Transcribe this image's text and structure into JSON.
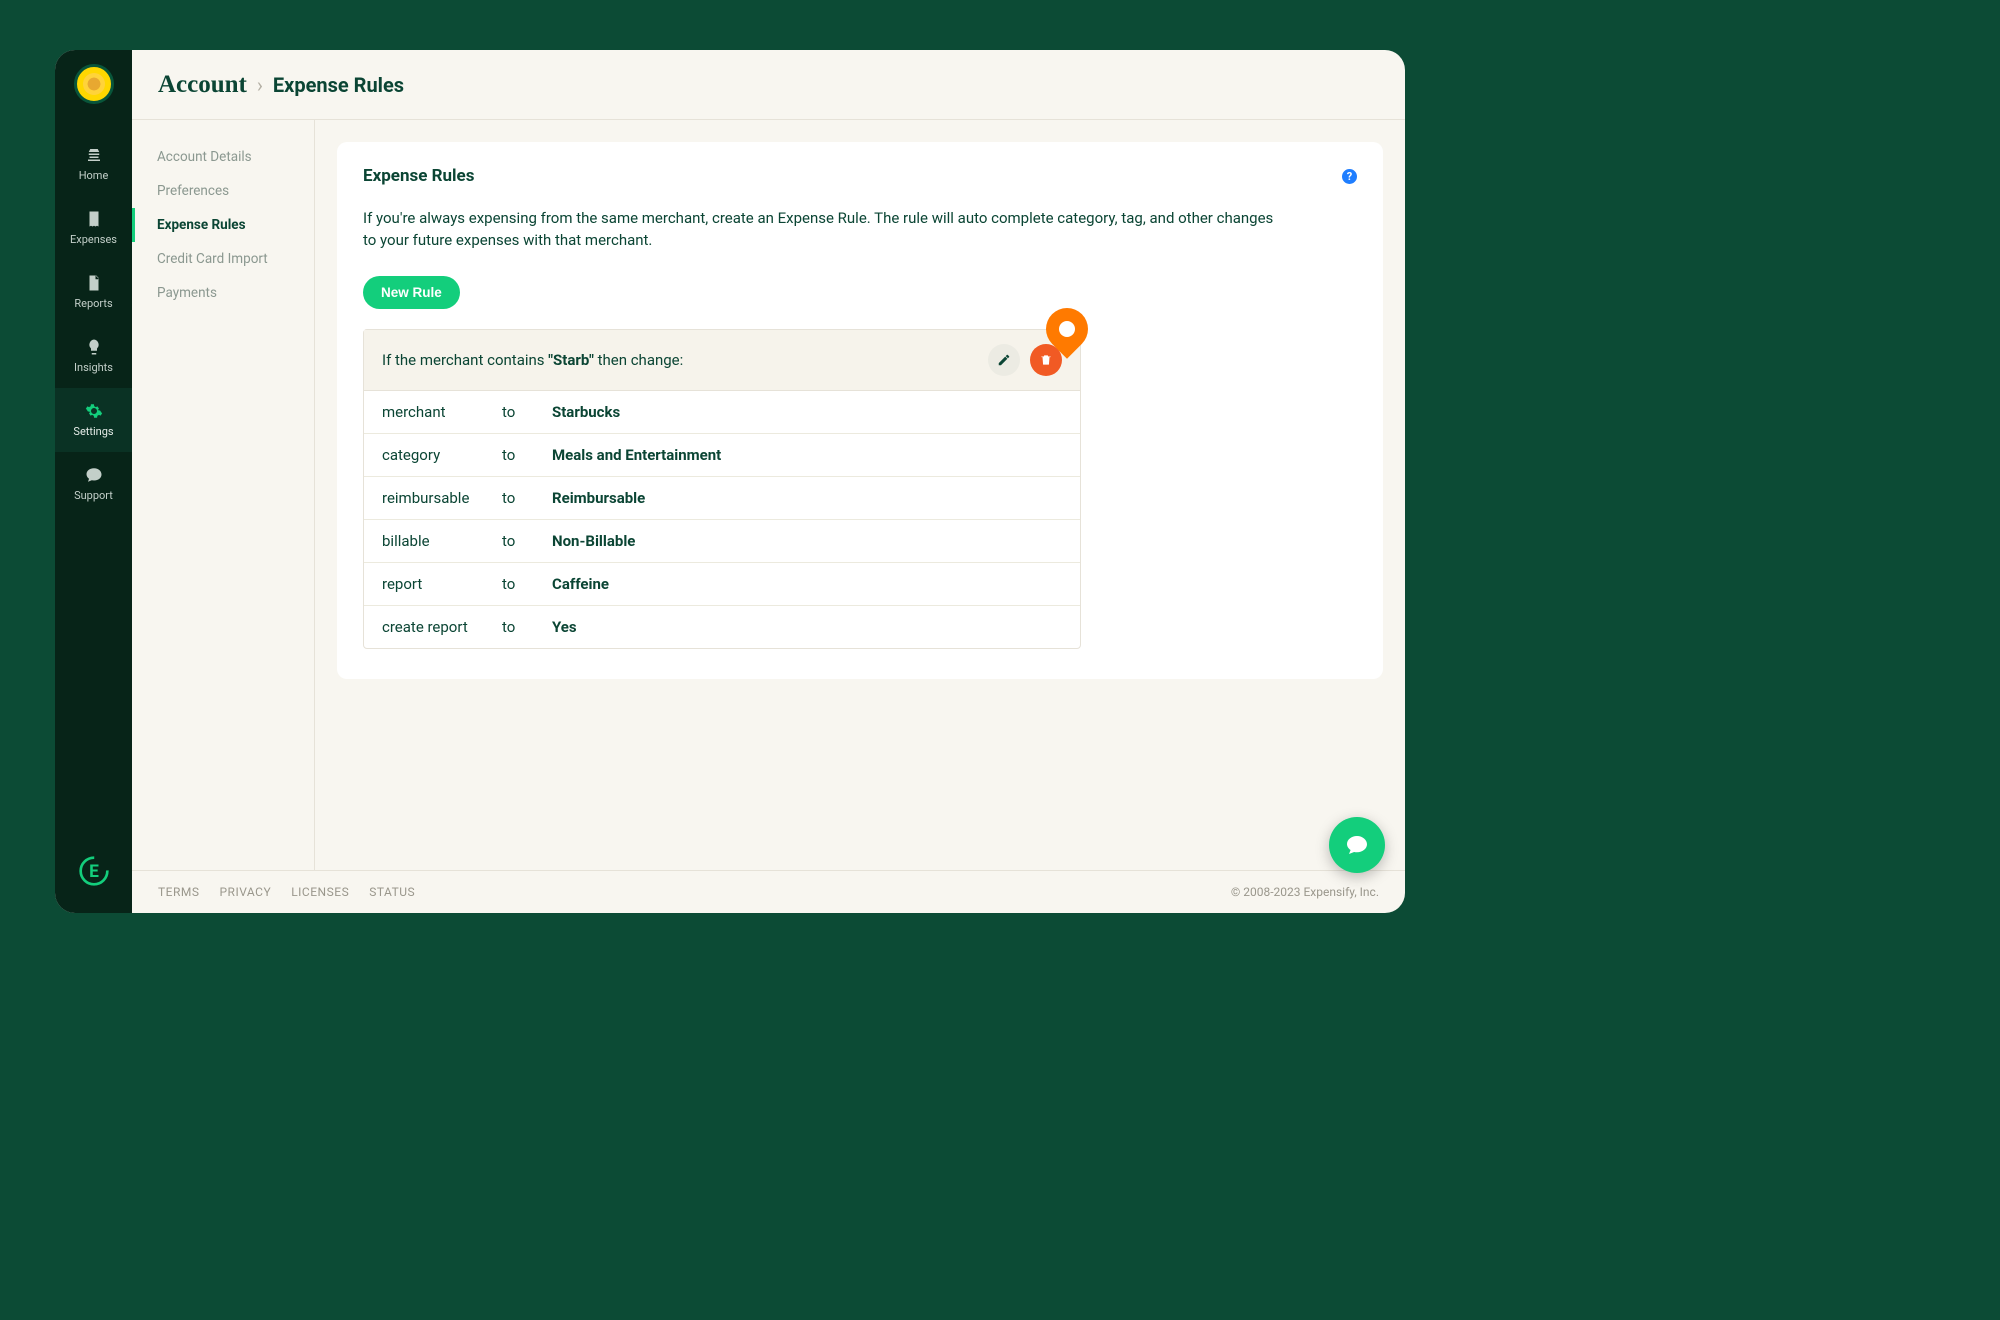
{
  "breadcrumb": {
    "root": "Account",
    "leaf": "Expense Rules"
  },
  "rail": {
    "items": [
      {
        "id": "home",
        "label": "Home"
      },
      {
        "id": "expenses",
        "label": "Expenses"
      },
      {
        "id": "reports",
        "label": "Reports"
      },
      {
        "id": "insights",
        "label": "Insights"
      },
      {
        "id": "settings",
        "label": "Settings"
      },
      {
        "id": "support",
        "label": "Support"
      }
    ]
  },
  "subnav": {
    "items": [
      {
        "id": "account-details",
        "label": "Account Details"
      },
      {
        "id": "preferences",
        "label": "Preferences"
      },
      {
        "id": "expense-rules",
        "label": "Expense Rules"
      },
      {
        "id": "cc-import",
        "label": "Credit Card Import"
      },
      {
        "id": "payments",
        "label": "Payments"
      }
    ]
  },
  "card": {
    "title": "Expense Rules",
    "description": "If you're always expensing from the same merchant, create an Expense Rule. The rule will auto complete category, tag, and other changes to your future expenses with that merchant.",
    "new_rule_label": "New Rule"
  },
  "rule": {
    "condition_prefix": "If the merchant contains ",
    "condition_value": "\"Starb\"",
    "condition_suffix": " then change:",
    "to_label": "to",
    "rows": [
      {
        "field": "merchant",
        "value": "Starbucks"
      },
      {
        "field": "category",
        "value": "Meals and Entertainment"
      },
      {
        "field": "reimbursable",
        "value": "Reimbursable"
      },
      {
        "field": "billable",
        "value": "Non-Billable"
      },
      {
        "field": "report",
        "value": "Caffeine"
      },
      {
        "field": "create report",
        "value": "Yes"
      }
    ]
  },
  "footer": {
    "links": [
      "TERMS",
      "PRIVACY",
      "LICENSES",
      "STATUS"
    ],
    "copyright": "© 2008-2023 Expensify, Inc."
  }
}
